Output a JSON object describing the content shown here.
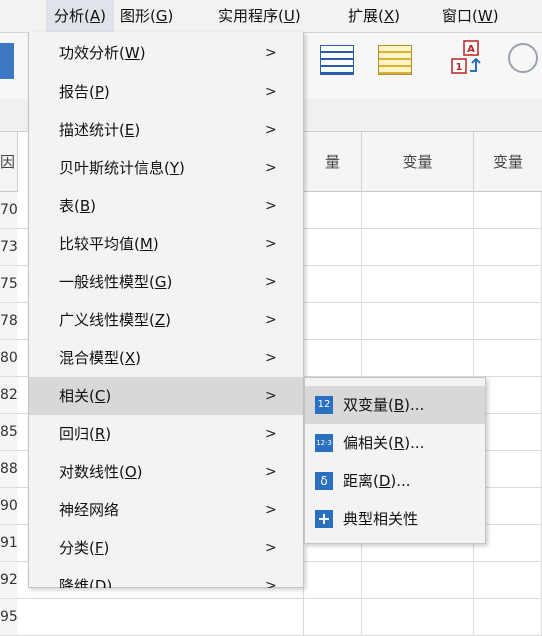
{
  "menubar": {
    "items": [
      {
        "text": "分析(",
        "key": "A",
        "end": ")"
      },
      {
        "text": "图形(",
        "key": "G",
        "end": ")"
      },
      {
        "text": "实用程序(",
        "key": "U",
        "end": ")"
      },
      {
        "text": "扩展(",
        "key": "X",
        "end": ")"
      },
      {
        "text": "窗口(",
        "key": "W",
        "end": ")"
      }
    ]
  },
  "grid": {
    "first_header_fragment": "因",
    "headers": [
      "量",
      "变量",
      "变量"
    ],
    "row_numbers": [
      "70",
      "73",
      "75",
      "78",
      "80",
      "82",
      "85",
      "88",
      "90",
      "91",
      "92",
      "95"
    ]
  },
  "analyze_menu": {
    "items": [
      {
        "text": "功效分析(",
        "key": "W",
        "end": ")"
      },
      {
        "text": "报告(",
        "key": "P",
        "end": ")"
      },
      {
        "text": "描述统计(",
        "key": "E",
        "end": ")"
      },
      {
        "text": "贝叶斯统计信息(",
        "key": "Y",
        "end": ")"
      },
      {
        "text": "表(",
        "key": "B",
        "end": ")"
      },
      {
        "text": "比较平均值(",
        "key": "M",
        "end": ")"
      },
      {
        "text": "一般线性模型(",
        "key": "G",
        "end": ")"
      },
      {
        "text": "广义线性模型(",
        "key": "Z",
        "end": ")"
      },
      {
        "text": "混合模型(",
        "key": "X",
        "end": ")"
      },
      {
        "text": "相关(",
        "key": "C",
        "end": ")"
      },
      {
        "text": "回归(",
        "key": "R",
        "end": ")"
      },
      {
        "text": "对数线性(",
        "key": "O",
        "end": ")"
      },
      {
        "text": "神经网络",
        "key": "",
        "end": ""
      },
      {
        "text": "分类(",
        "key": "F",
        "end": ")"
      },
      {
        "text": "降维(",
        "key": "D",
        "end": ")"
      }
    ],
    "arrow": ">"
  },
  "correlate_submenu": {
    "items": [
      {
        "text": "双变量(",
        "key": "B",
        "end": ")...",
        "icon": "bivariate-icon",
        "icon_text": "12"
      },
      {
        "text": "偏相关(",
        "key": "R",
        "end": ")...",
        "icon": "partial-correlation-icon",
        "icon_text": "12·3"
      },
      {
        "text": "距离(",
        "key": "D",
        "end": ")...",
        "icon": "distance-icon",
        "icon_text": "δ"
      },
      {
        "text": "典型相关性",
        "key": "",
        "end": "",
        "icon": "canonical-correlation-icon",
        "icon_text": "+"
      }
    ]
  },
  "colors": {
    "menu_bg": "#f3f3f3",
    "highlight": "#d8d8d8",
    "icon_blue": "#2a6fc0"
  }
}
